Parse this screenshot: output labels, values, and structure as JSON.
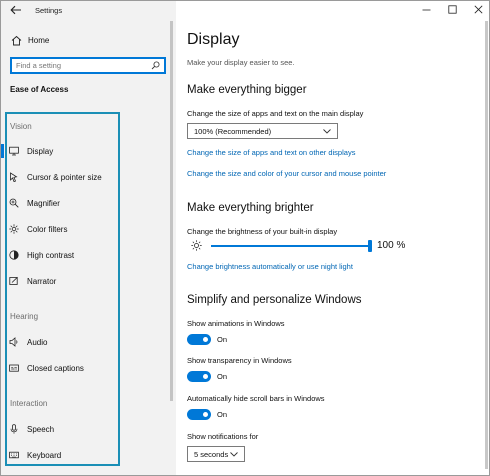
{
  "window": {
    "title": "Settings"
  },
  "sidebar": {
    "home_label": "Home",
    "search_placeholder": "Find a setting",
    "section_title": "Ease of Access",
    "groups": [
      {
        "label": "Vision"
      },
      {
        "label": "Hearing"
      },
      {
        "label": "Interaction"
      }
    ],
    "items": [
      {
        "label": "Display",
        "icon": "monitor-icon",
        "selected": true
      },
      {
        "label": "Cursor & pointer size",
        "icon": "cursor-icon"
      },
      {
        "label": "Magnifier",
        "icon": "magnifier-icon"
      },
      {
        "label": "Color filters",
        "icon": "color-filter-icon"
      },
      {
        "label": "High contrast",
        "icon": "high-contrast-icon"
      },
      {
        "label": "Narrator",
        "icon": "narrator-icon"
      },
      {
        "label": "Audio",
        "icon": "speaker-icon"
      },
      {
        "label": "Closed captions",
        "icon": "captions-icon"
      },
      {
        "label": "Speech",
        "icon": "microphone-icon"
      },
      {
        "label": "Keyboard",
        "icon": "keyboard-icon"
      }
    ]
  },
  "main": {
    "title": "Display",
    "subtitle": "Make your display easier to see.",
    "bigger": {
      "heading": "Make everything bigger",
      "label": "Change the size of apps and text on the main display",
      "dropdown_value": "100% (Recommended)",
      "link1": "Change the size of apps and text on other displays",
      "link2": "Change the size and color of your cursor and mouse pointer"
    },
    "brighter": {
      "heading": "Make everything brighter",
      "label": "Change the brightness of your built-in display",
      "value_text": "100 %",
      "value": 100,
      "link": "Change brightness automatically or use night light"
    },
    "simplify": {
      "heading": "Simplify and personalize Windows",
      "animations_label": "Show animations in Windows",
      "animations_state": "On",
      "transparency_label": "Show transparency in Windows",
      "transparency_state": "On",
      "scrollbars_label": "Automatically hide scroll bars in Windows",
      "scrollbars_state": "On",
      "notifications_label": "Show notifications for",
      "notifications_value": "5 seconds"
    }
  },
  "colors": {
    "accent": "#0078d7",
    "link": "#0066b4",
    "highlight_frame": "#1b8fb6",
    "sidebar_bg": "#f2f2f2"
  }
}
